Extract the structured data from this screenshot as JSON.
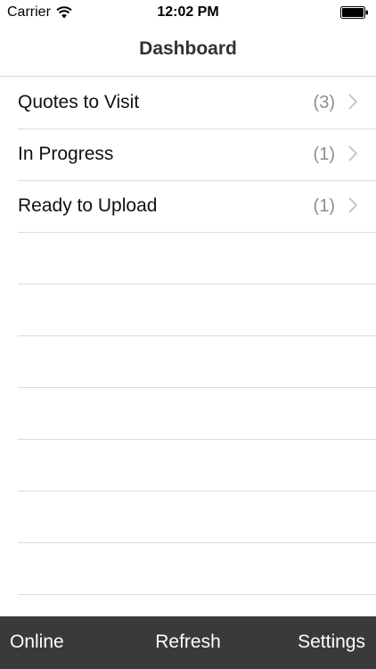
{
  "status_bar": {
    "carrier": "Carrier",
    "time": "12:02 PM",
    "wifi_icon": "wifi-icon",
    "battery_icon": "battery-icon"
  },
  "nav": {
    "title": "Dashboard"
  },
  "list": {
    "items": [
      {
        "label": "Quotes to Visit",
        "count": "(3)"
      },
      {
        "label": "In Progress",
        "count": "(1)"
      },
      {
        "label": "Ready to Upload",
        "count": "(1)"
      }
    ],
    "chevron_icon": "chevron-right-icon"
  },
  "toolbar": {
    "online_label": "Online",
    "refresh_label": "Refresh",
    "settings_label": "Settings",
    "background_color": "#3a3a3a"
  }
}
